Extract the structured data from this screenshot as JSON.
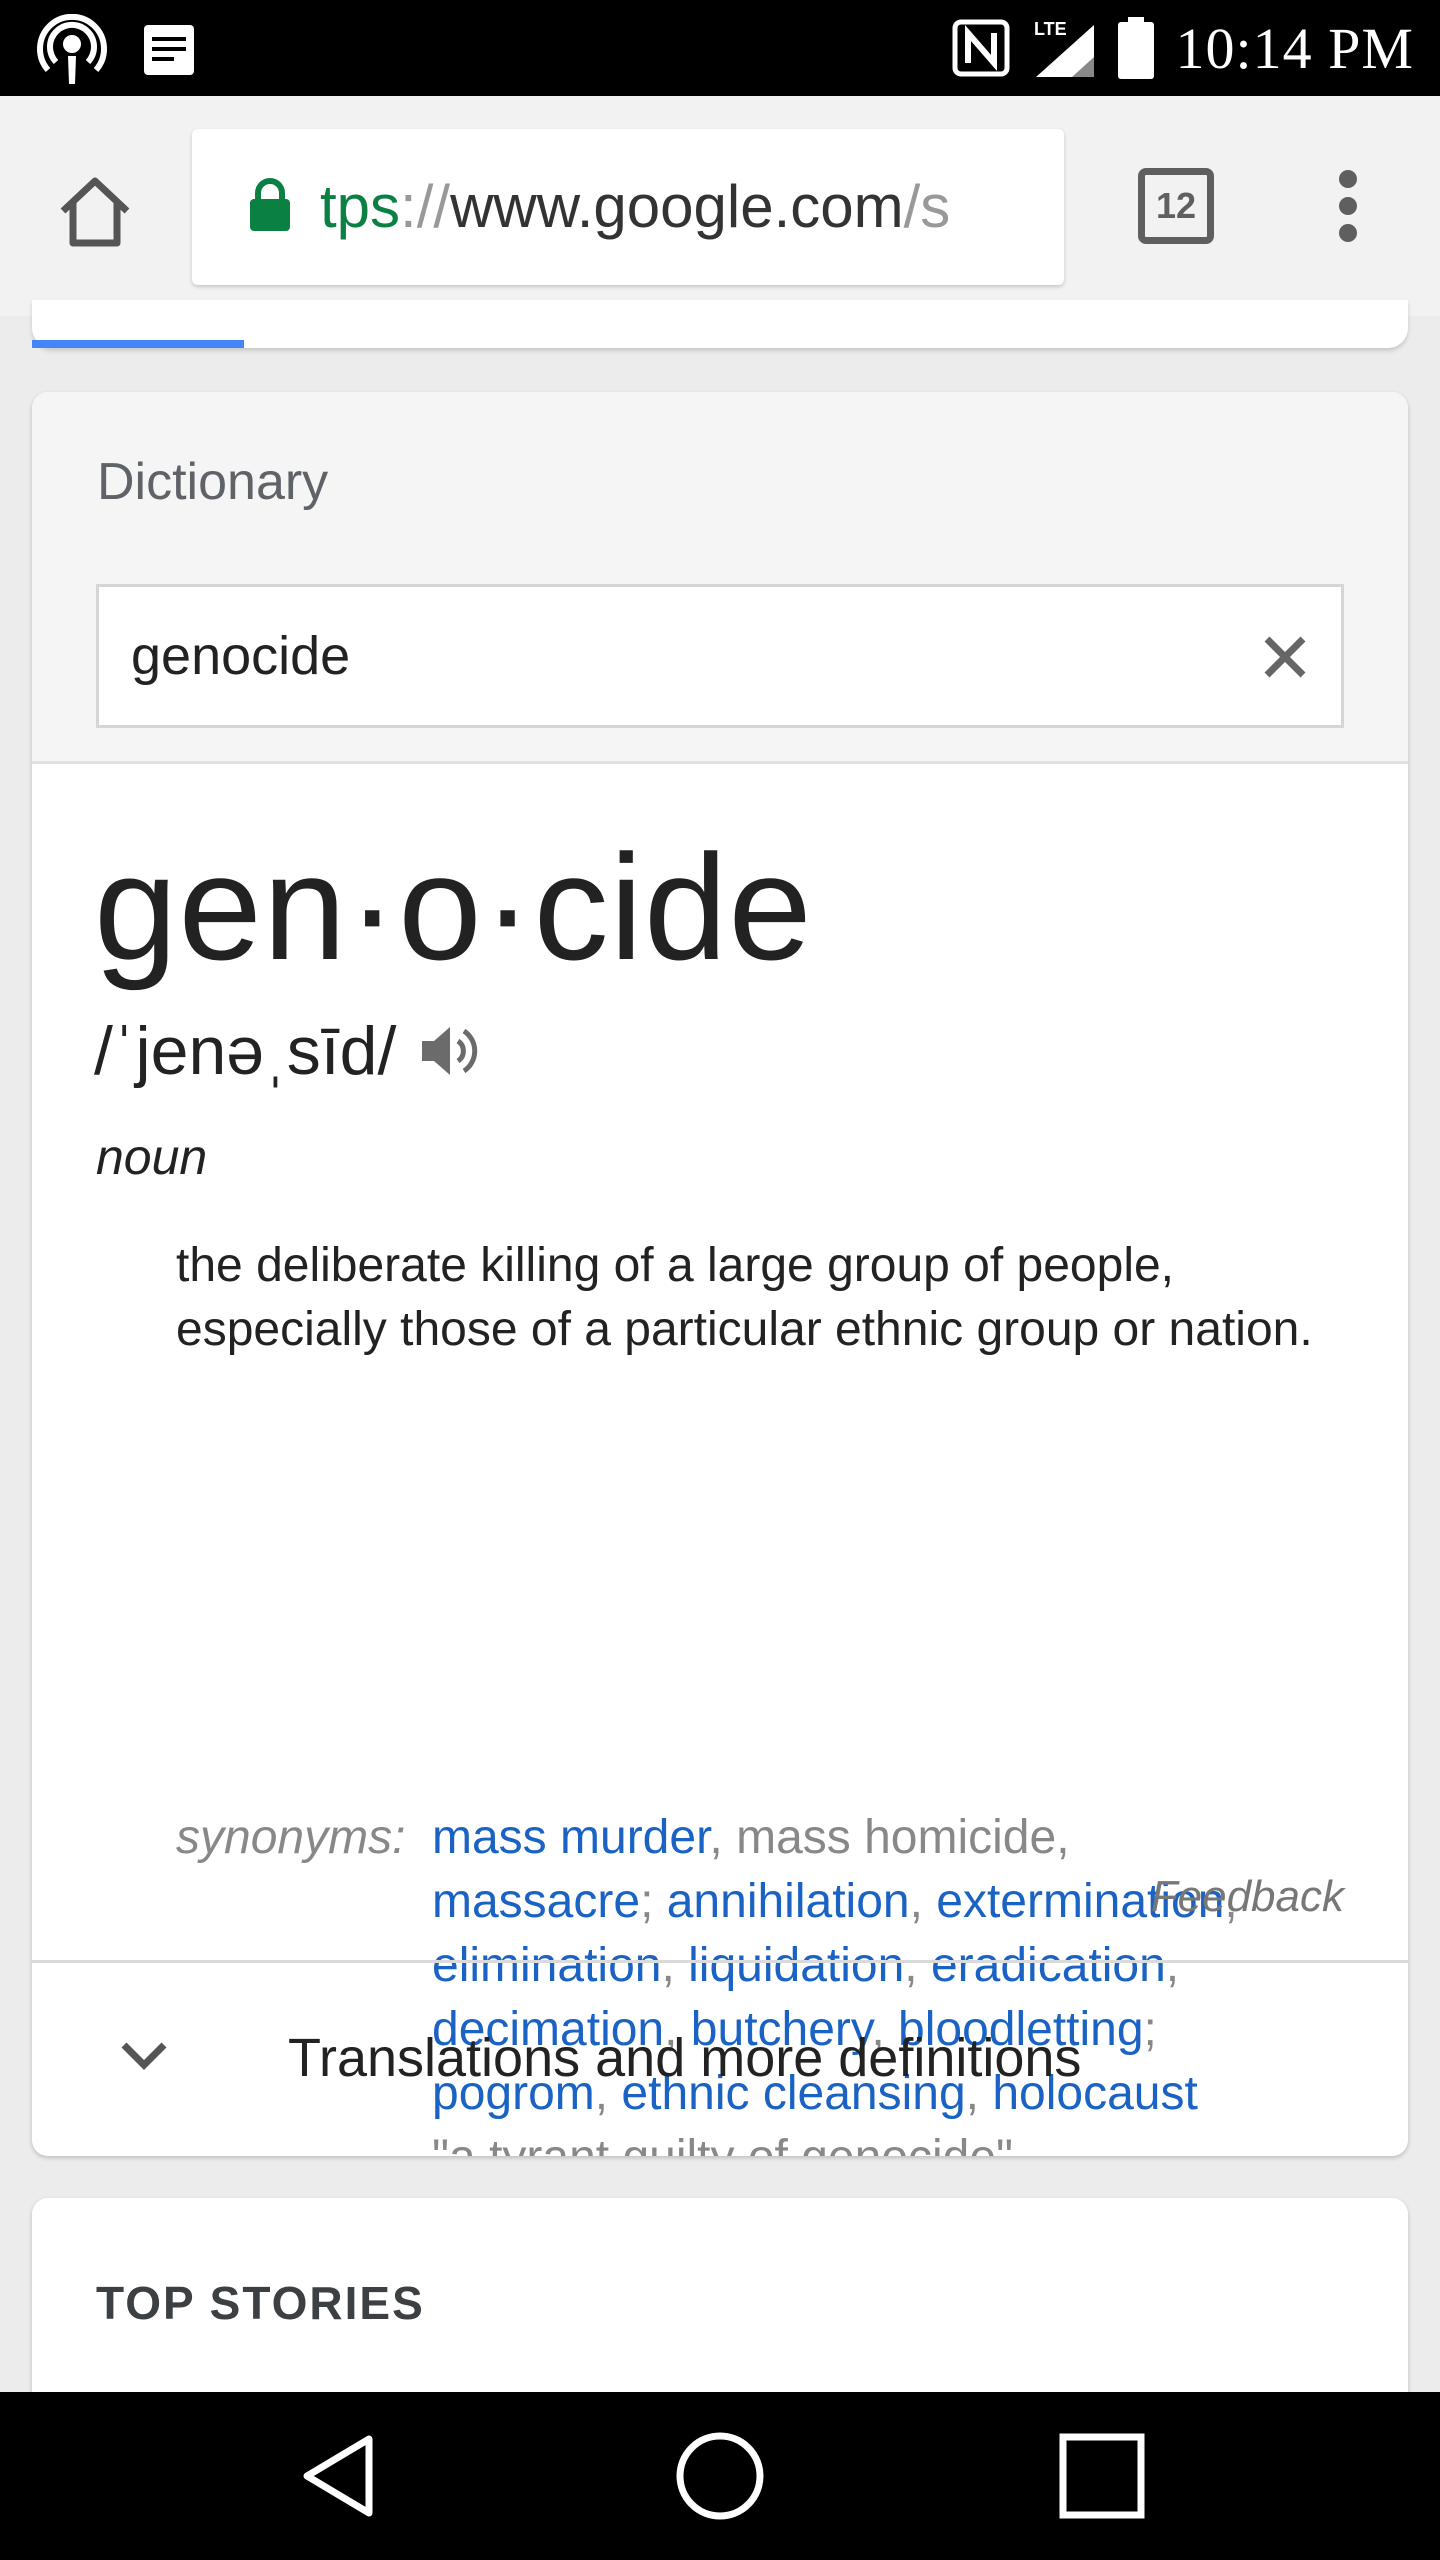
{
  "status_bar": {
    "time": "10:14 PM",
    "network_label": "LTE",
    "left_icons": [
      "podcast-icon",
      "notes-icon"
    ],
    "right_icons": [
      "nfc-icon",
      "signal-icon",
      "battery-icon"
    ]
  },
  "browser": {
    "url_scheme": "tps",
    "url_sep": "://",
    "url_host": "www.google.com",
    "url_rest": "/s",
    "tab_count": "12",
    "colors": {
      "secure": "#0b8043"
    }
  },
  "dictionary": {
    "title": "Dictionary",
    "search_value": "genocide",
    "headword": "gen·o·cide",
    "pronunciation": "/ˈjenəˌsīd/",
    "part_of_speech": "noun",
    "definition": "the deliberate killing of a large group of people, especially those of a particular ethnic group or nation.",
    "synonyms_label": "synonyms:",
    "synonym_lines": [
      [
        {
          "text": "mass murder",
          "link": true
        },
        {
          "text": ", mass homicide,",
          "link": false
        }
      ],
      [
        {
          "text": "massacre",
          "link": true
        },
        {
          "text": "; ",
          "link": false
        },
        {
          "text": "annihilation",
          "link": true
        },
        {
          "text": ", ",
          "link": false
        },
        {
          "text": "extermination",
          "link": true
        },
        {
          "text": ",",
          "link": false
        }
      ],
      [
        {
          "text": "elimination",
          "link": true
        },
        {
          "text": ", ",
          "link": false
        },
        {
          "text": "liquidation",
          "link": true
        },
        {
          "text": ", ",
          "link": false
        },
        {
          "text": "eradication",
          "link": true
        },
        {
          "text": ",",
          "link": false
        }
      ],
      [
        {
          "text": "decimation",
          "link": true
        },
        {
          "text": ", ",
          "link": false
        },
        {
          "text": "butchery",
          "link": true
        },
        {
          "text": ", ",
          "link": false
        },
        {
          "text": "bloodletting",
          "link": true
        },
        {
          "text": ";",
          "link": false
        }
      ],
      [
        {
          "text": "pogrom",
          "link": true
        },
        {
          "text": ", ",
          "link": false
        },
        {
          "text": "ethnic cleansing",
          "link": true
        },
        {
          "text": ", ",
          "link": false
        },
        {
          "text": "holocaust",
          "link": true
        }
      ]
    ],
    "example": "\"a tyrant guilty of genocide\"",
    "feedback": "Feedback",
    "more_label": "Translations and more definitions",
    "colors": {
      "link": "#1a62c4"
    }
  },
  "top_stories": {
    "title": "TOP STORIES"
  },
  "nav_bar": {
    "icons": [
      "back-icon",
      "home-icon",
      "recents-icon"
    ]
  }
}
